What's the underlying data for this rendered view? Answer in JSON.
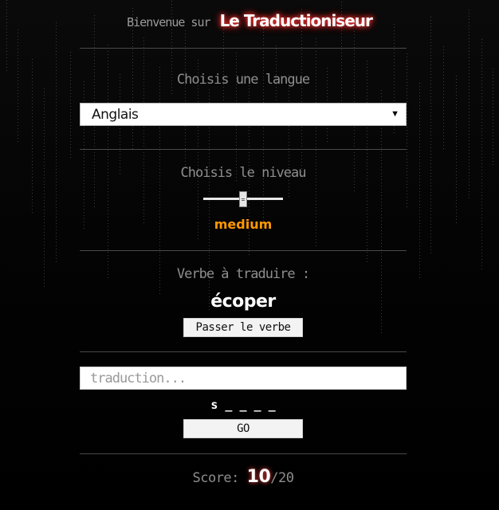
{
  "header": {
    "prefix": "Bienvenue sur",
    "brand": "Le Traductioniseur"
  },
  "language": {
    "label": "Choisis une langue",
    "selected": "Anglais"
  },
  "level": {
    "label": "Choisis le niveau",
    "value_name": "medium",
    "slider_value": 0.5
  },
  "verb": {
    "label": "Verbe à traduire :",
    "word": "écoper",
    "skip_label": "Passer le verbe"
  },
  "answer": {
    "placeholder": "traduction...",
    "value": "",
    "hint": "s _ _ _ _",
    "go_label": "GO"
  },
  "score": {
    "label": "Score:",
    "current": "10",
    "separator": "/",
    "total": "20"
  },
  "colors": {
    "background": "#050505",
    "accent": "#ff9900",
    "glow": "#ff3b3b"
  }
}
